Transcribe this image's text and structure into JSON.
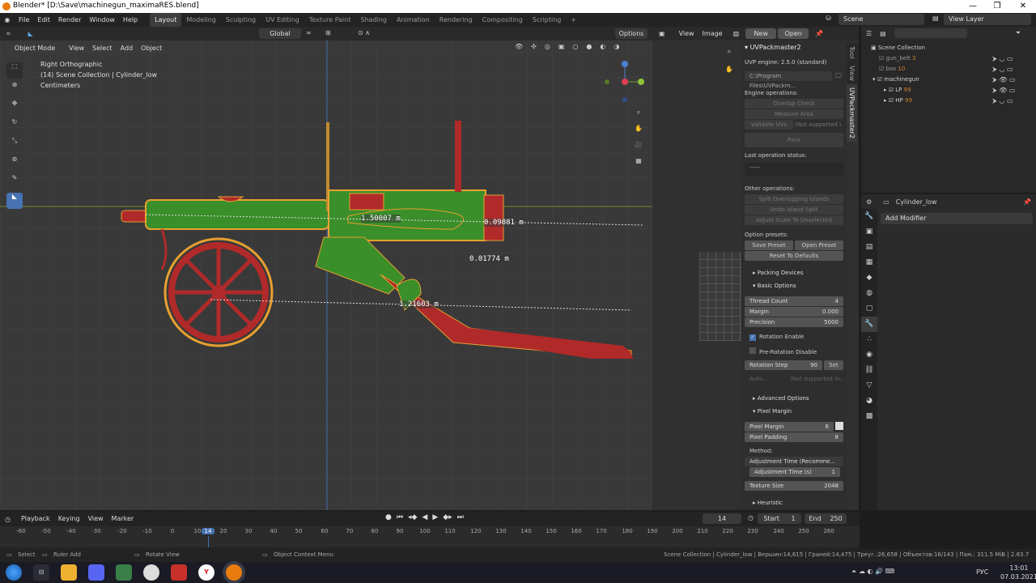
{
  "window": {
    "title": "Blender* [D:\\Save\\machinegun_maximaRES.blend]",
    "minimize": "—",
    "maximize": "❐",
    "close": "✕"
  },
  "menus": [
    "File",
    "Edit",
    "Render",
    "Window",
    "Help"
  ],
  "workspaces": [
    "Layout",
    "Modeling",
    "Sculpting",
    "UV Editing",
    "Texture Paint",
    "Shading",
    "Animation",
    "Rendering",
    "Compositing",
    "Scripting"
  ],
  "workspace_add": "+",
  "scene": "Scene",
  "view_layer": "View Layer",
  "viewport": {
    "mode": "Object Mode",
    "menus": [
      "View",
      "Select",
      "Add",
      "Object"
    ],
    "transform": "Global",
    "options": "Options",
    "info_view": "Right Orthographic",
    "info_collection": "(14) Scene Collection | Cylinder_low",
    "info_units": "Centimeters",
    "measures": [
      "1.50007 m",
      "0.09881 m",
      "0.01774 m",
      "1.21603 m"
    ]
  },
  "image_editor": {
    "menus": [
      "View",
      "Image"
    ],
    "new": "New",
    "open": "Open"
  },
  "uvp": {
    "header": "UVPackmaster2",
    "engine": "UVP engine: 2.5.0 (standard)",
    "path": "C:\\Program Files\\UVPackm...",
    "engine_ops": "Engine operations:",
    "overlap_check": "Overlap Check",
    "measure_area": "Measure Area",
    "validate": "Validate UVs",
    "not_supported": "(Not supported i...",
    "pack": "Pack",
    "last_status": "Last operation status:",
    "status_val": "-----",
    "other_ops": "Other operations:",
    "split_overlap": "Split Overlapping Islands",
    "undo_split": "Undo Island Split",
    "adjust_scale": "Adjust Scale To Unselected",
    "presets": "Option presets:",
    "save_preset": "Save Preset",
    "open_preset": "Open Preset",
    "reset": "Reset To Defaults",
    "packing_devices": "Packing Devices",
    "basic_options": "Basic Options",
    "thread_count_l": "Thread Count",
    "thread_count": "4",
    "margin_l": "Margin",
    "margin": "0.000",
    "precision_l": "Precision",
    "precision": "5000",
    "rotation_enable": "Rotation Enable",
    "prerotation": "Pre-Rotation Disable",
    "rotation_step_l": "Rotation Step",
    "rotation_step": "90",
    "set": "Set",
    "auto": "Auto...",
    "auto_ns": "(Not supported in...",
    "advanced": "Advanced Options",
    "pixel_margin_sec": "Pixel Margin",
    "pixel_margin_l": "Pixel Margin",
    "pixel_margin": "6",
    "pixel_padding_l": "Pixel Padding",
    "pixel_padding": "8",
    "method_l": "Method:",
    "method": "Adjustment Time (Recomme...",
    "adj_time_l": "Adjustment Time (s)",
    "adj_time": "1",
    "tex_size_l": "Texture Size",
    "tex_size": "2048",
    "heuristic": "Heuristic",
    "tabs": [
      "Tool",
      "View",
      "UVPackmaster2"
    ]
  },
  "outliner": {
    "root": "Scene Collection",
    "items": [
      {
        "name": "gun_belt",
        "badge": "3"
      },
      {
        "name": "box",
        "badge": "10"
      },
      {
        "name": "machinegun",
        "badge": ""
      },
      {
        "name": "LP",
        "badge": "99"
      },
      {
        "name": "HP",
        "badge": "99"
      }
    ]
  },
  "props": {
    "object": "Cylinder_low",
    "add_modifier": "Add Modifier"
  },
  "timeline": {
    "menus": [
      "Playback",
      "Keying",
      "View",
      "Marker"
    ],
    "frame": "14",
    "start_l": "Start",
    "start": "1",
    "end_l": "End",
    "end": "250",
    "ticks": [
      "-60",
      "-50",
      "-40",
      "-30",
      "-20",
      "-10",
      "0",
      "10",
      "14",
      "20",
      "30",
      "40",
      "50",
      "60",
      "70",
      "80",
      "90",
      "100",
      "110",
      "120",
      "130",
      "140",
      "150",
      "160",
      "170",
      "180",
      "190",
      "200",
      "210",
      "220",
      "230",
      "240",
      "250",
      "260"
    ]
  },
  "status": {
    "select": "Select",
    "ruler": "Ruler Add",
    "rotate": "Rotate View",
    "context": "Object Context Menu",
    "info": "Scene Collection | Cylinder_low | Вершин:14,615 | Граней:14,475 | Треуг.:26,658 | Объектов:16/143 | Пам.: 311.5 MiB | 2.83.7"
  },
  "taskbar": {
    "lang": "РУС",
    "time": "13:01",
    "date": "07.03.2021"
  },
  "colors": {
    "accent": "#4772b3",
    "green": "#3a8f2a",
    "red": "#b02a2a",
    "outline": "#e8a030"
  }
}
